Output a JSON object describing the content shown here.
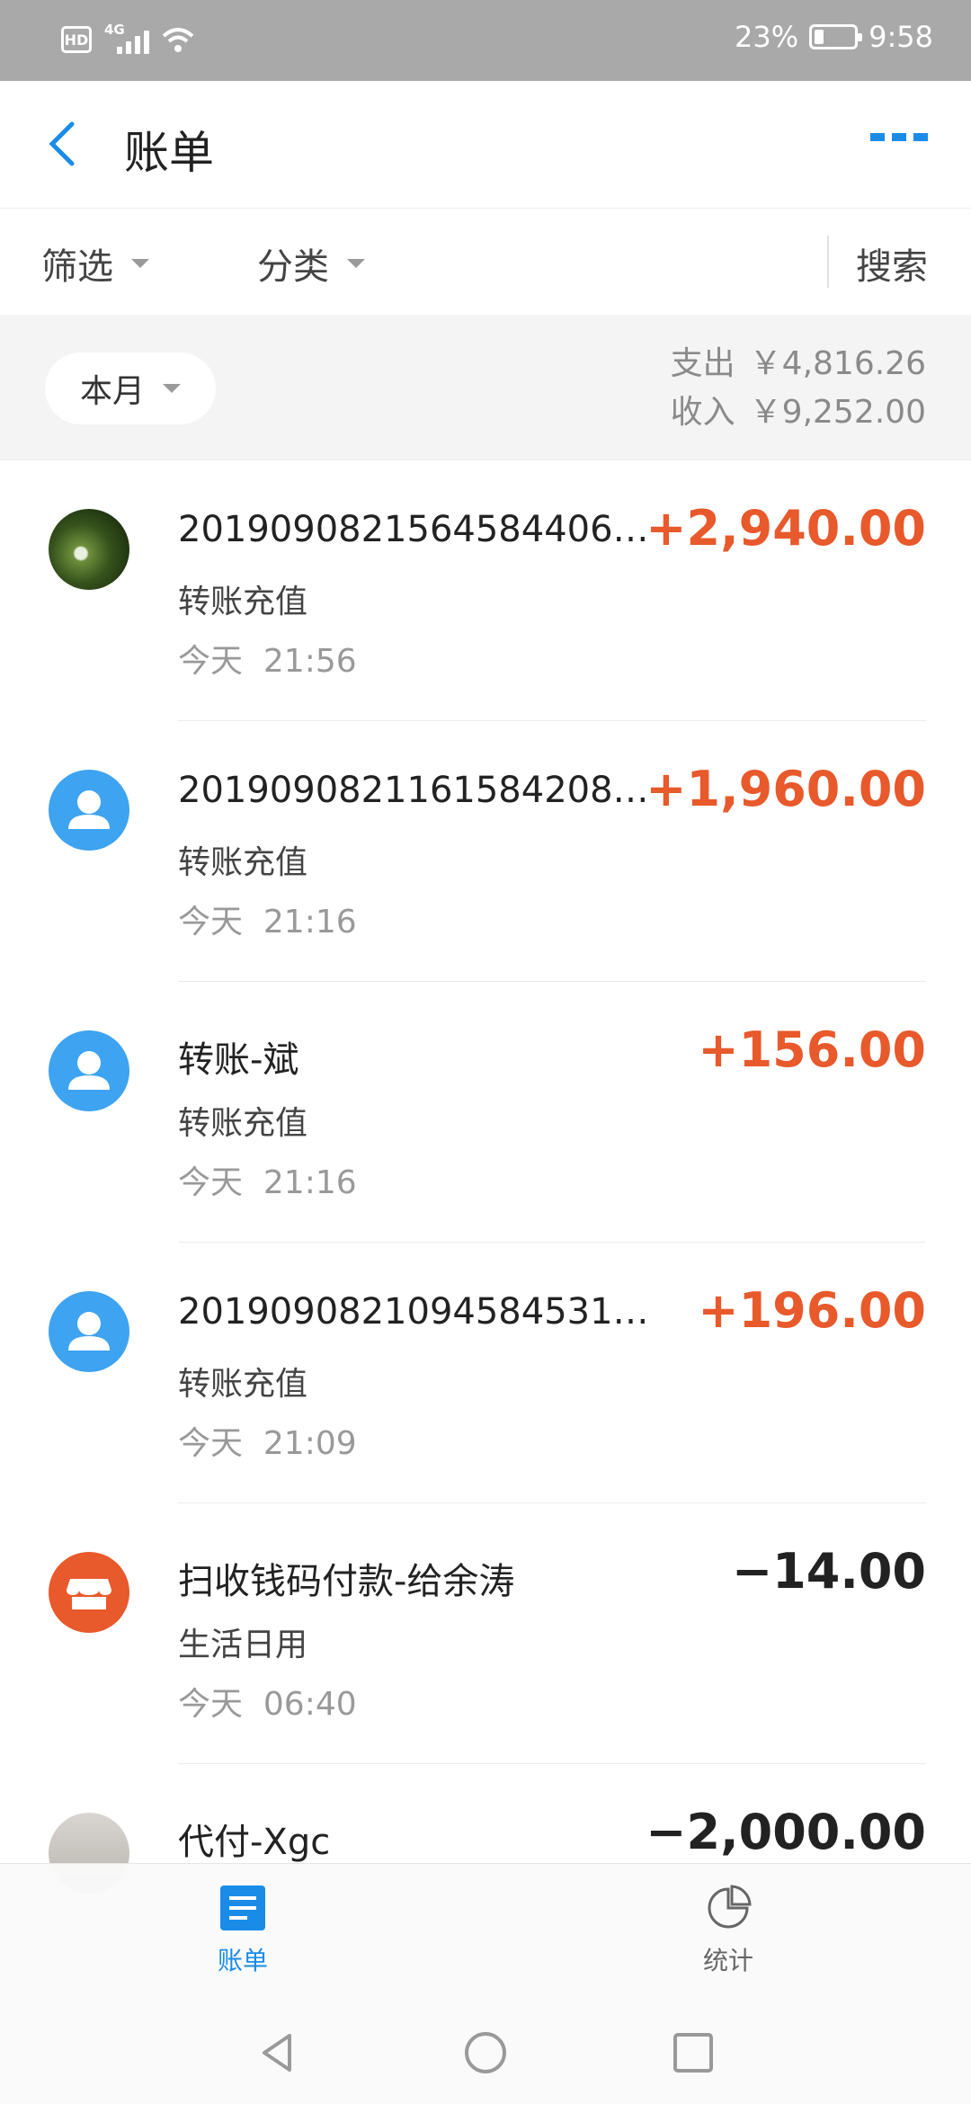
{
  "status_bar": {
    "hd": "HD",
    "network": "4G",
    "battery_percent_text": "23%",
    "battery_level": 0.23,
    "time": "9:58"
  },
  "header": {
    "title": "账单",
    "back_icon": "chevron-left-icon",
    "more_icon": "more-dots-icon"
  },
  "filters": {
    "filter_label": "筛选",
    "category_label": "分类",
    "search_label": "搜索"
  },
  "summary": {
    "month_label": "本月",
    "expense_label": "支出",
    "expense_amount": "￥4,816.26",
    "income_label": "收入",
    "income_amount": "￥9,252.00"
  },
  "transactions": [
    {
      "name": "20190908215645844066...",
      "category": "转账充值",
      "day": "今天",
      "time": "21:56",
      "amount": "+2,940.00",
      "direction": "in",
      "avatar": "photo"
    },
    {
      "name": "20190908211615842080...",
      "category": "转账充值",
      "day": "今天",
      "time": "21:16",
      "amount": "+1,960.00",
      "direction": "in",
      "avatar": "person-icon"
    },
    {
      "name": "转账-斌",
      "category": "转账充值",
      "day": "今天",
      "time": "21:16",
      "amount": "+156.00",
      "direction": "in",
      "avatar": "person-icon"
    },
    {
      "name": "20190908210945845314...",
      "category": "转账充值",
      "day": "今天",
      "time": "21:09",
      "amount": "+196.00",
      "direction": "in",
      "avatar": "person-icon"
    },
    {
      "name": "扫收钱码付款-给余涛",
      "category": "生活日用",
      "day": "今天",
      "time": "06:40",
      "amount": "−14.00",
      "direction": "out",
      "avatar": "shop-icon"
    },
    {
      "name": "代付-Xgc",
      "category": "",
      "day": "",
      "time": "",
      "amount": "−2,000.00",
      "direction": "out",
      "avatar": "photo"
    }
  ],
  "tabbar": {
    "bill_label": "账单",
    "stats_label": "统计"
  },
  "colors": {
    "accent": "#1a8ce8",
    "income": "#e8592b",
    "status_bar": "#a9a9a9"
  }
}
